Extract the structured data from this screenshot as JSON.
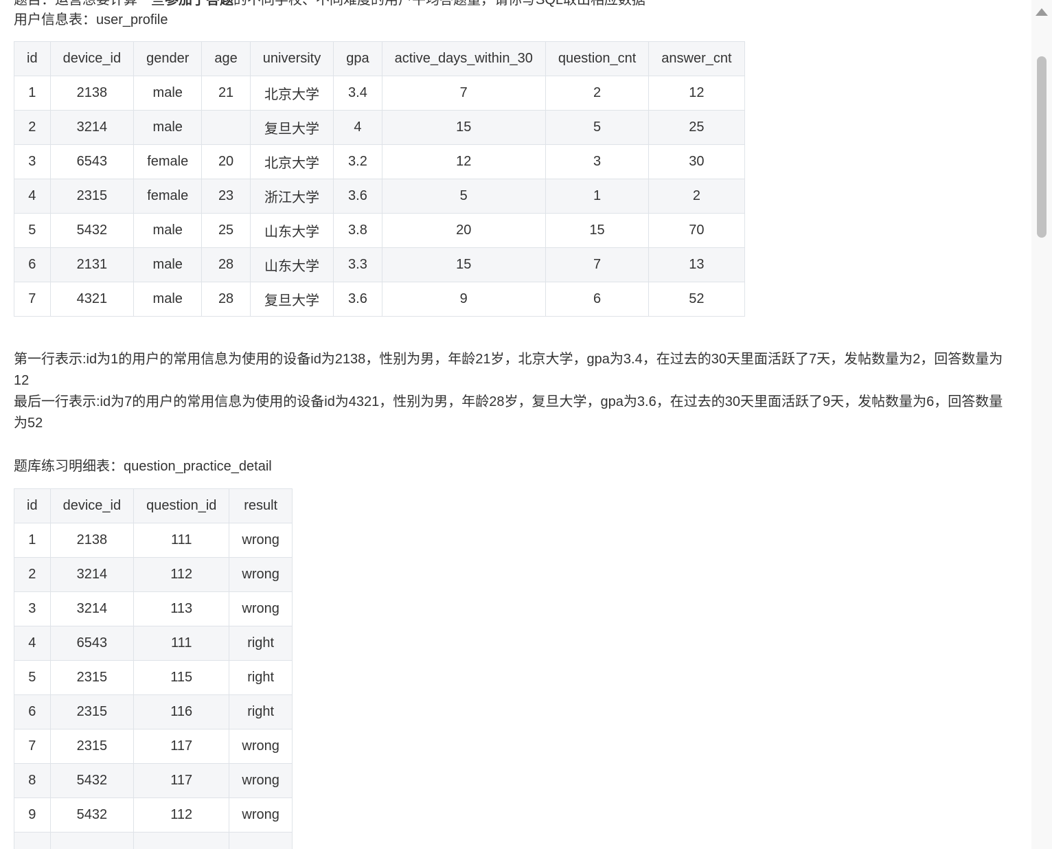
{
  "intro": {
    "cut_line": {
      "part1": "题目：运营想要计算一些",
      "bold": "参加了答题",
      "part2": "的不同学校、不同难度的用户平均答题量，请你写SQL取出相应数据"
    },
    "table1_label": "用户信息表：user_profile"
  },
  "user_profile": {
    "headers": [
      "id",
      "device_id",
      "gender",
      "age",
      "university",
      "gpa",
      "active_days_within_30",
      "question_cnt",
      "answer_cnt"
    ],
    "rows": [
      [
        "1",
        "2138",
        "male",
        "21",
        "北京大学",
        "3.4",
        "7",
        "2",
        "12"
      ],
      [
        "2",
        "3214",
        "male",
        "",
        "复旦大学",
        "4",
        "15",
        "5",
        "25"
      ],
      [
        "3",
        "6543",
        "female",
        "20",
        "北京大学",
        "3.2",
        "12",
        "3",
        "30"
      ],
      [
        "4",
        "2315",
        "female",
        "23",
        "浙江大学",
        "3.6",
        "5",
        "1",
        "2"
      ],
      [
        "5",
        "5432",
        "male",
        "25",
        "山东大学",
        "3.8",
        "20",
        "15",
        "70"
      ],
      [
        "6",
        "2131",
        "male",
        "28",
        "山东大学",
        "3.3",
        "15",
        "7",
        "13"
      ],
      [
        "7",
        "4321",
        "male",
        "28",
        "复旦大学",
        "3.6",
        "9",
        "6",
        "52"
      ]
    ]
  },
  "explanation": {
    "first_row": "第一行表示:id为1的用户的常用信息为使用的设备id为2138，性别为男，年龄21岁，北京大学，gpa为3.4，在过去的30天里面活跃了7天，发帖数量为2，回答数量为12",
    "last_row": "最后一行表示:id为7的用户的常用信息为使用的设备id为4321，性别为男，年龄28岁，复旦大学，gpa为3.6，在过去的30天里面活跃了9天，发帖数量为6，回答数量为52"
  },
  "table2_label": "题库练习明细表：question_practice_detail",
  "question_practice_detail": {
    "headers": [
      "id",
      "device_id",
      "question_id",
      "result"
    ],
    "rows": [
      [
        "1",
        "2138",
        "111",
        "wrong"
      ],
      [
        "2",
        "3214",
        "112",
        "wrong"
      ],
      [
        "3",
        "3214",
        "113",
        "wrong"
      ],
      [
        "4",
        "6543",
        "111",
        "right"
      ],
      [
        "5",
        "2315",
        "115",
        "right"
      ],
      [
        "6",
        "2315",
        "116",
        "right"
      ],
      [
        "7",
        "2315",
        "117",
        "wrong"
      ],
      [
        "8",
        "5432",
        "117",
        "wrong"
      ],
      [
        "9",
        "5432",
        "112",
        "wrong"
      ],
      [
        "",
        "",
        "",
        ""
      ]
    ]
  },
  "scrollbar": {
    "up_icon": "triangle-up-icon",
    "position_fraction": 0.04
  }
}
